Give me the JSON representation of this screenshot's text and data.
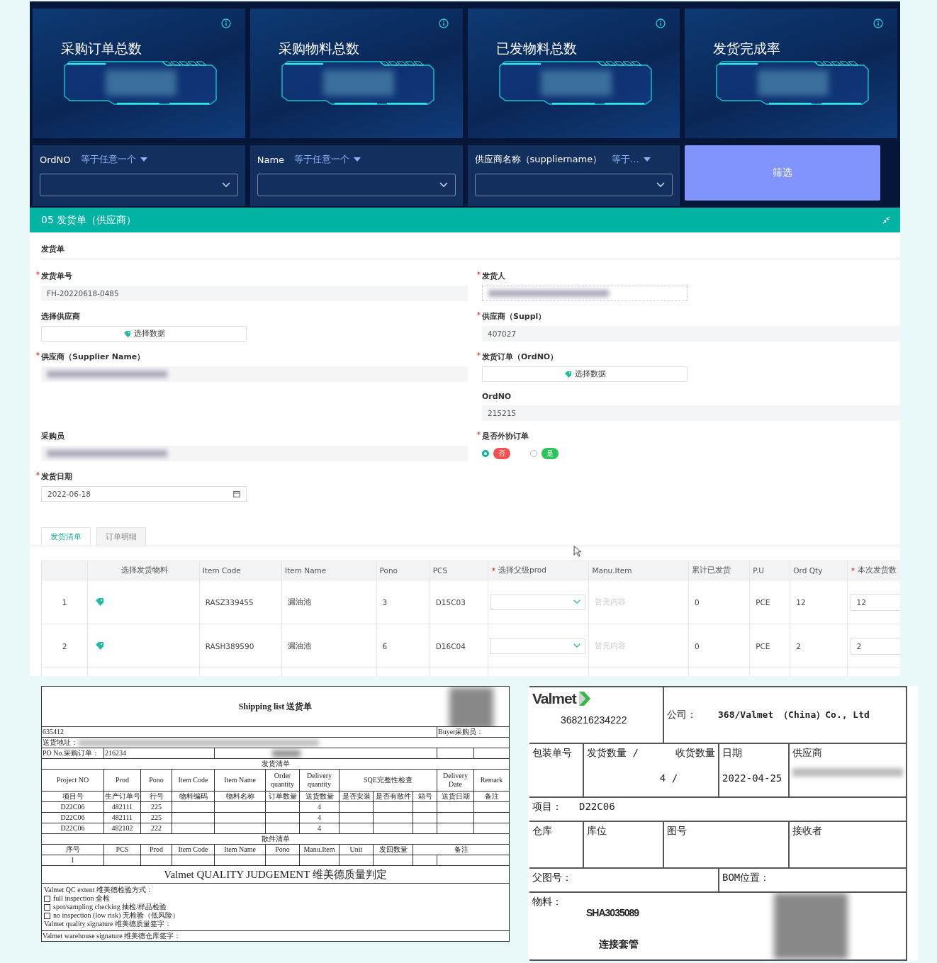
{
  "kpi_cards": [
    {
      "title": "采购订单总数"
    },
    {
      "title": "采购物料总数"
    },
    {
      "title": "已发物料总数"
    },
    {
      "title": "发货完成率"
    }
  ],
  "filters": [
    {
      "field": "OrdNO",
      "operator": "等于任意一个"
    },
    {
      "field": "Name",
      "operator": "等于任意一个"
    },
    {
      "field": "供应商名称（suppliername）",
      "operator": "等于..."
    }
  ],
  "filter_button": "筛选",
  "panel_title": "05 发货单（供应商）",
  "form": {
    "section": "发货单",
    "rows": [
      {
        "left": {
          "label": "发货单号",
          "required": true,
          "kind": "text",
          "value": "FH-20220618-0485"
        },
        "right": {
          "label": "发货人",
          "required": true,
          "kind": "redacted-dashed"
        }
      },
      {
        "left": {
          "label": "选择供应商",
          "required": false,
          "kind": "button",
          "value": "选择数据"
        },
        "right": {
          "label": "供应商（Suppl）",
          "required": true,
          "kind": "text",
          "value": "407027"
        }
      },
      {
        "left": {
          "label": "供应商（Supplier Name）",
          "required": true,
          "kind": "redacted"
        },
        "right": {
          "label": "发货订单（OrdNO）",
          "required": true,
          "kind": "button",
          "value": "选择数据"
        }
      },
      {
        "right": {
          "label": "OrdNO",
          "required": false,
          "kind": "text",
          "value": "215215"
        }
      },
      {
        "left": {
          "label": "采购员",
          "required": false,
          "kind": "redacted"
        },
        "right": {
          "label": "是否外协订单",
          "required": true,
          "kind": "radio",
          "options": [
            {
              "label": "否",
              "color": "#f5504f",
              "selected": true
            },
            {
              "label": "是",
              "color": "#2cc35b",
              "selected": false
            }
          ]
        }
      },
      {
        "left": {
          "label": "发货日期",
          "required": true,
          "kind": "date",
          "value": "2022-06-18"
        }
      }
    ]
  },
  "tabs": [
    {
      "label": "发货清单",
      "selected": true
    },
    {
      "label": "订单明细",
      "selected": false
    }
  ],
  "table": {
    "columns": [
      {
        "label": "选择发货物料",
        "required": false
      },
      {
        "label": "Item Code",
        "required": false
      },
      {
        "label": "Item Name",
        "required": false
      },
      {
        "label": "Pono",
        "required": false
      },
      {
        "label": "PCS",
        "required": false
      },
      {
        "label": "选择父级prod",
        "required": true
      },
      {
        "label": "Manu.Item",
        "required": false
      },
      {
        "label": "累计已发货",
        "required": false
      },
      {
        "label": "P.U",
        "required": false
      },
      {
        "label": "Ord Qty",
        "required": false
      },
      {
        "label": "本次发货数",
        "required": true
      }
    ],
    "rows": [
      {
        "index": "1",
        "item_code": "RASZ339455",
        "item_name": "漏油池",
        "pono": "3",
        "pcs": "D15C03",
        "manu_item": "暂无内容",
        "shipped": "0",
        "pu": "PCE",
        "ord_qty": "12",
        "qty": "12"
      },
      {
        "index": "2",
        "item_code": "RASH389590",
        "item_name": "漏油池",
        "pono": "6",
        "pcs": "D16C04",
        "manu_item": "暂无内容",
        "shipped": "0",
        "pu": "PCE",
        "ord_qty": "2",
        "qty": "2"
      }
    ]
  },
  "shipping_list": {
    "title": "Shipping list 送货单",
    "number": "635412",
    "buyer_label": "Buyer采购员：",
    "address_label": "送货地址：",
    "po_label": "PO No.采购订单：",
    "po_value": "216234",
    "section_1": "发货清单",
    "header_en": [
      "Project NO",
      "Prod",
      "Pono",
      "Item Code",
      "Item Name",
      "Order quantity",
      "Delivery quantity",
      "SQE完整性检查",
      "Delivery Date",
      "Remark"
    ],
    "header_zh": [
      "项目号",
      "生产订单号",
      "行号",
      "物料编码",
      "物料名称",
      "订单数量",
      "送货数量",
      "是否安装",
      "是否有散件",
      "箱号",
      "送货日期",
      "备注"
    ],
    "rows": [
      {
        "project": "D22C06",
        "prod": "482111",
        "pono": "225",
        "delivery_qty": "4"
      },
      {
        "project": "D22C06",
        "prod": "482111",
        "pono": "225",
        "delivery_qty": "4"
      },
      {
        "project": "D22C06",
        "prod": "482102",
        "pono": "222",
        "delivery_qty": "4"
      }
    ],
    "section_2": "散件清单",
    "parts_header": [
      "序号",
      "PCS",
      "Prod",
      "Item Code",
      "Item Name",
      "Pono",
      "Manu.Item",
      "Unit",
      "发回数量",
      "备注"
    ],
    "parts_rows": [
      {
        "index": "1"
      }
    ],
    "quality_title": "Valmet QUALITY JUDGEMENT 维美德质量判定",
    "qc_lines": [
      {
        "kind": "text",
        "text": "Valmet QC extent 维美德检验方式："
      },
      {
        "kind": "checkbox",
        "checked": false,
        "text": "full inspection 全检"
      },
      {
        "kind": "checkbox",
        "checked": false,
        "text": "spot/sampling checking 抽检/样品检验"
      },
      {
        "kind": "checkbox",
        "checked": false,
        "text": "no inspection (low risk) 无检验（低风险）"
      },
      {
        "kind": "text",
        "text": "Valmet quality signature 维美德质量签字："
      }
    ],
    "warehouse_signature": "Valmet warehouse signature 维美德仓库签字："
  },
  "label": {
    "logo": "Valmet",
    "code": "368216234222",
    "company_label": "公司：",
    "company": "368/Valmet （China）Co., Ltd",
    "package_no_label": "包装单号",
    "ship_qty_label": "发货数量 /",
    "recv_qty_label": "收货数量",
    "qty_value": "4 /",
    "date_label": "日期",
    "date": "2022-04-25",
    "supplier_label": "供应商",
    "project_label": "项目：",
    "project": "D22C06",
    "warehouse_label": "仓库",
    "location_label": "库位",
    "drawing_label": "图号",
    "receiver_label": "接收者",
    "parent_drawing_label": "父图号：",
    "bom_label": "BOM位置：",
    "material_label": "物料：",
    "material_code": "SHA3035089",
    "material_name": "连接套管"
  }
}
